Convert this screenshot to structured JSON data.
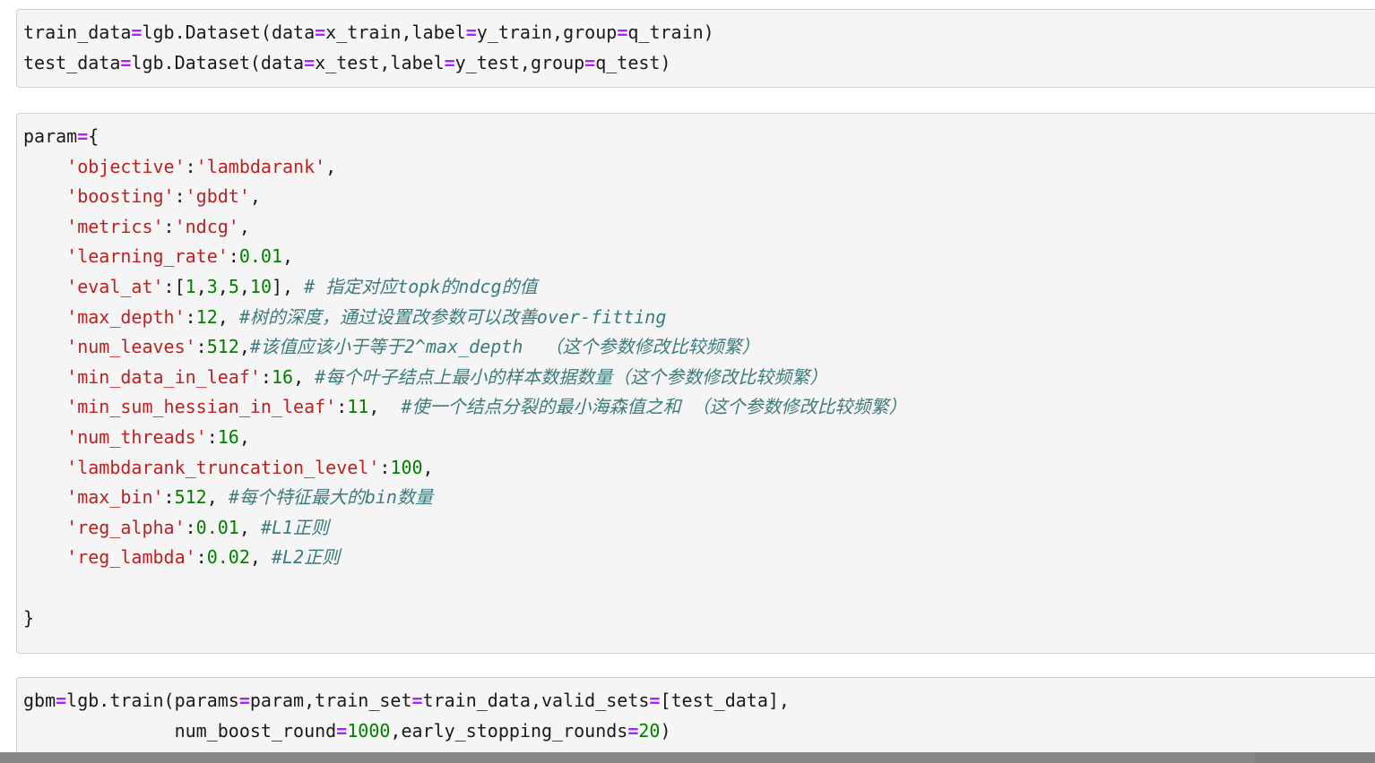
{
  "document": {
    "kind": "jupyter-notebook-code-cells",
    "language": "python",
    "colors": {
      "background": "#ffffff",
      "block_background": "#f5f5f5",
      "block_border": "#cfcfcf",
      "text": "#1a1a1a",
      "operator": "#aa22ff",
      "string": "#ba2121",
      "number": "#008000",
      "comment": "#3d7b7b",
      "scrollbar": "#808080"
    }
  },
  "blocks": [
    {
      "id": "dataset-cell",
      "lines": [
        [
          {
            "t": "plain",
            "s": "train_data"
          },
          {
            "t": "op",
            "s": "="
          },
          {
            "t": "plain",
            "s": "lgb.Dataset(data"
          },
          {
            "t": "op",
            "s": "="
          },
          {
            "t": "plain",
            "s": "x_train,label"
          },
          {
            "t": "op",
            "s": "="
          },
          {
            "t": "plain",
            "s": "y_train,group"
          },
          {
            "t": "op",
            "s": "="
          },
          {
            "t": "plain",
            "s": "q_train)"
          }
        ],
        [
          {
            "t": "plain",
            "s": "test_data"
          },
          {
            "t": "op",
            "s": "="
          },
          {
            "t": "plain",
            "s": "lgb.Dataset(data"
          },
          {
            "t": "op",
            "s": "="
          },
          {
            "t": "plain",
            "s": "x_test,label"
          },
          {
            "t": "op",
            "s": "="
          },
          {
            "t": "plain",
            "s": "y_test,group"
          },
          {
            "t": "op",
            "s": "="
          },
          {
            "t": "plain",
            "s": "q_test)"
          }
        ]
      ]
    },
    {
      "id": "param-cell",
      "lines": [
        [
          {
            "t": "plain",
            "s": "param"
          },
          {
            "t": "op",
            "s": "="
          },
          {
            "t": "punc",
            "s": "{"
          }
        ],
        [
          {
            "t": "plain",
            "s": "    "
          },
          {
            "t": "str",
            "s": "'objective'"
          },
          {
            "t": "punc",
            "s": ":"
          },
          {
            "t": "str",
            "s": "'lambdarank'"
          },
          {
            "t": "punc",
            "s": ","
          }
        ],
        [
          {
            "t": "plain",
            "s": "    "
          },
          {
            "t": "str",
            "s": "'boosting'"
          },
          {
            "t": "punc",
            "s": ":"
          },
          {
            "t": "str",
            "s": "'gbdt'"
          },
          {
            "t": "punc",
            "s": ","
          }
        ],
        [
          {
            "t": "plain",
            "s": "    "
          },
          {
            "t": "str",
            "s": "'metrics'"
          },
          {
            "t": "punc",
            "s": ":"
          },
          {
            "t": "str",
            "s": "'ndcg'"
          },
          {
            "t": "punc",
            "s": ","
          }
        ],
        [
          {
            "t": "plain",
            "s": "    "
          },
          {
            "t": "str",
            "s": "'learning_rate'"
          },
          {
            "t": "punc",
            "s": ":"
          },
          {
            "t": "num",
            "s": "0.01"
          },
          {
            "t": "punc",
            "s": ","
          }
        ],
        [
          {
            "t": "plain",
            "s": "    "
          },
          {
            "t": "str",
            "s": "'eval_at'"
          },
          {
            "t": "punc",
            "s": ":["
          },
          {
            "t": "num",
            "s": "1"
          },
          {
            "t": "punc",
            "s": ","
          },
          {
            "t": "num",
            "s": "3"
          },
          {
            "t": "punc",
            "s": ","
          },
          {
            "t": "num",
            "s": "5"
          },
          {
            "t": "punc",
            "s": ","
          },
          {
            "t": "num",
            "s": "10"
          },
          {
            "t": "punc",
            "s": "], "
          },
          {
            "t": "com",
            "s": "# 指定对应topk的ndcg的值"
          }
        ],
        [
          {
            "t": "plain",
            "s": "    "
          },
          {
            "t": "str",
            "s": "'max_depth'"
          },
          {
            "t": "punc",
            "s": ":"
          },
          {
            "t": "num",
            "s": "12"
          },
          {
            "t": "punc",
            "s": ", "
          },
          {
            "t": "com",
            "s": "#树的深度，通过设置改参数可以改善over-fitting"
          }
        ],
        [
          {
            "t": "plain",
            "s": "    "
          },
          {
            "t": "str",
            "s": "'num_leaves'"
          },
          {
            "t": "punc",
            "s": ":"
          },
          {
            "t": "num",
            "s": "512"
          },
          {
            "t": "punc",
            "s": ","
          },
          {
            "t": "com",
            "s": "#该值应该小于等于2^max_depth  （这个参数修改比较频繁）"
          }
        ],
        [
          {
            "t": "plain",
            "s": "    "
          },
          {
            "t": "str",
            "s": "'min_data_in_leaf'"
          },
          {
            "t": "punc",
            "s": ":"
          },
          {
            "t": "num",
            "s": "16"
          },
          {
            "t": "punc",
            "s": ", "
          },
          {
            "t": "com",
            "s": "#每个叶子结点上最小的样本数据数量（这个参数修改比较频繁）"
          }
        ],
        [
          {
            "t": "plain",
            "s": "    "
          },
          {
            "t": "str",
            "s": "'min_sum_hessian_in_leaf'"
          },
          {
            "t": "punc",
            "s": ":"
          },
          {
            "t": "num",
            "s": "11"
          },
          {
            "t": "punc",
            "s": ",  "
          },
          {
            "t": "com",
            "s": "#使一个结点分裂的最小海森值之和 （这个参数修改比较频繁）"
          }
        ],
        [
          {
            "t": "plain",
            "s": "    "
          },
          {
            "t": "str",
            "s": "'num_threads'"
          },
          {
            "t": "punc",
            "s": ":"
          },
          {
            "t": "num",
            "s": "16"
          },
          {
            "t": "punc",
            "s": ","
          }
        ],
        [
          {
            "t": "plain",
            "s": "    "
          },
          {
            "t": "str",
            "s": "'lambdarank_truncation_level'"
          },
          {
            "t": "punc",
            "s": ":"
          },
          {
            "t": "num",
            "s": "100"
          },
          {
            "t": "punc",
            "s": ","
          }
        ],
        [
          {
            "t": "plain",
            "s": "    "
          },
          {
            "t": "str",
            "s": "'max_bin'"
          },
          {
            "t": "punc",
            "s": ":"
          },
          {
            "t": "num",
            "s": "512"
          },
          {
            "t": "punc",
            "s": ", "
          },
          {
            "t": "com",
            "s": "#每个特征最大的bin数量"
          }
        ],
        [
          {
            "t": "plain",
            "s": "    "
          },
          {
            "t": "str",
            "s": "'reg_alpha'"
          },
          {
            "t": "punc",
            "s": ":"
          },
          {
            "t": "num",
            "s": "0.01"
          },
          {
            "t": "punc",
            "s": ", "
          },
          {
            "t": "com",
            "s": "#L1正则"
          }
        ],
        [
          {
            "t": "plain",
            "s": "    "
          },
          {
            "t": "str",
            "s": "'reg_lambda'"
          },
          {
            "t": "punc",
            "s": ":"
          },
          {
            "t": "num",
            "s": "0.02"
          },
          {
            "t": "punc",
            "s": ", "
          },
          {
            "t": "com",
            "s": "#L2正则"
          }
        ],
        [],
        [
          {
            "t": "punc",
            "s": "}"
          }
        ]
      ]
    },
    {
      "id": "train-cell",
      "lines": [
        [
          {
            "t": "plain",
            "s": "gbm"
          },
          {
            "t": "op",
            "s": "="
          },
          {
            "t": "plain",
            "s": "lgb.train(params"
          },
          {
            "t": "op",
            "s": "="
          },
          {
            "t": "plain",
            "s": "param,train_set"
          },
          {
            "t": "op",
            "s": "="
          },
          {
            "t": "plain",
            "s": "train_data,valid_sets"
          },
          {
            "t": "op",
            "s": "="
          },
          {
            "t": "plain",
            "s": "[test_data],"
          }
        ],
        [
          {
            "t": "plain",
            "s": "              num_boost_round"
          },
          {
            "t": "op",
            "s": "="
          },
          {
            "t": "num",
            "s": "1000"
          },
          {
            "t": "plain",
            "s": ",early_stopping_rounds"
          },
          {
            "t": "op",
            "s": "="
          },
          {
            "t": "num",
            "s": "20"
          },
          {
            "t": "plain",
            "s": ")"
          }
        ]
      ]
    }
  ]
}
